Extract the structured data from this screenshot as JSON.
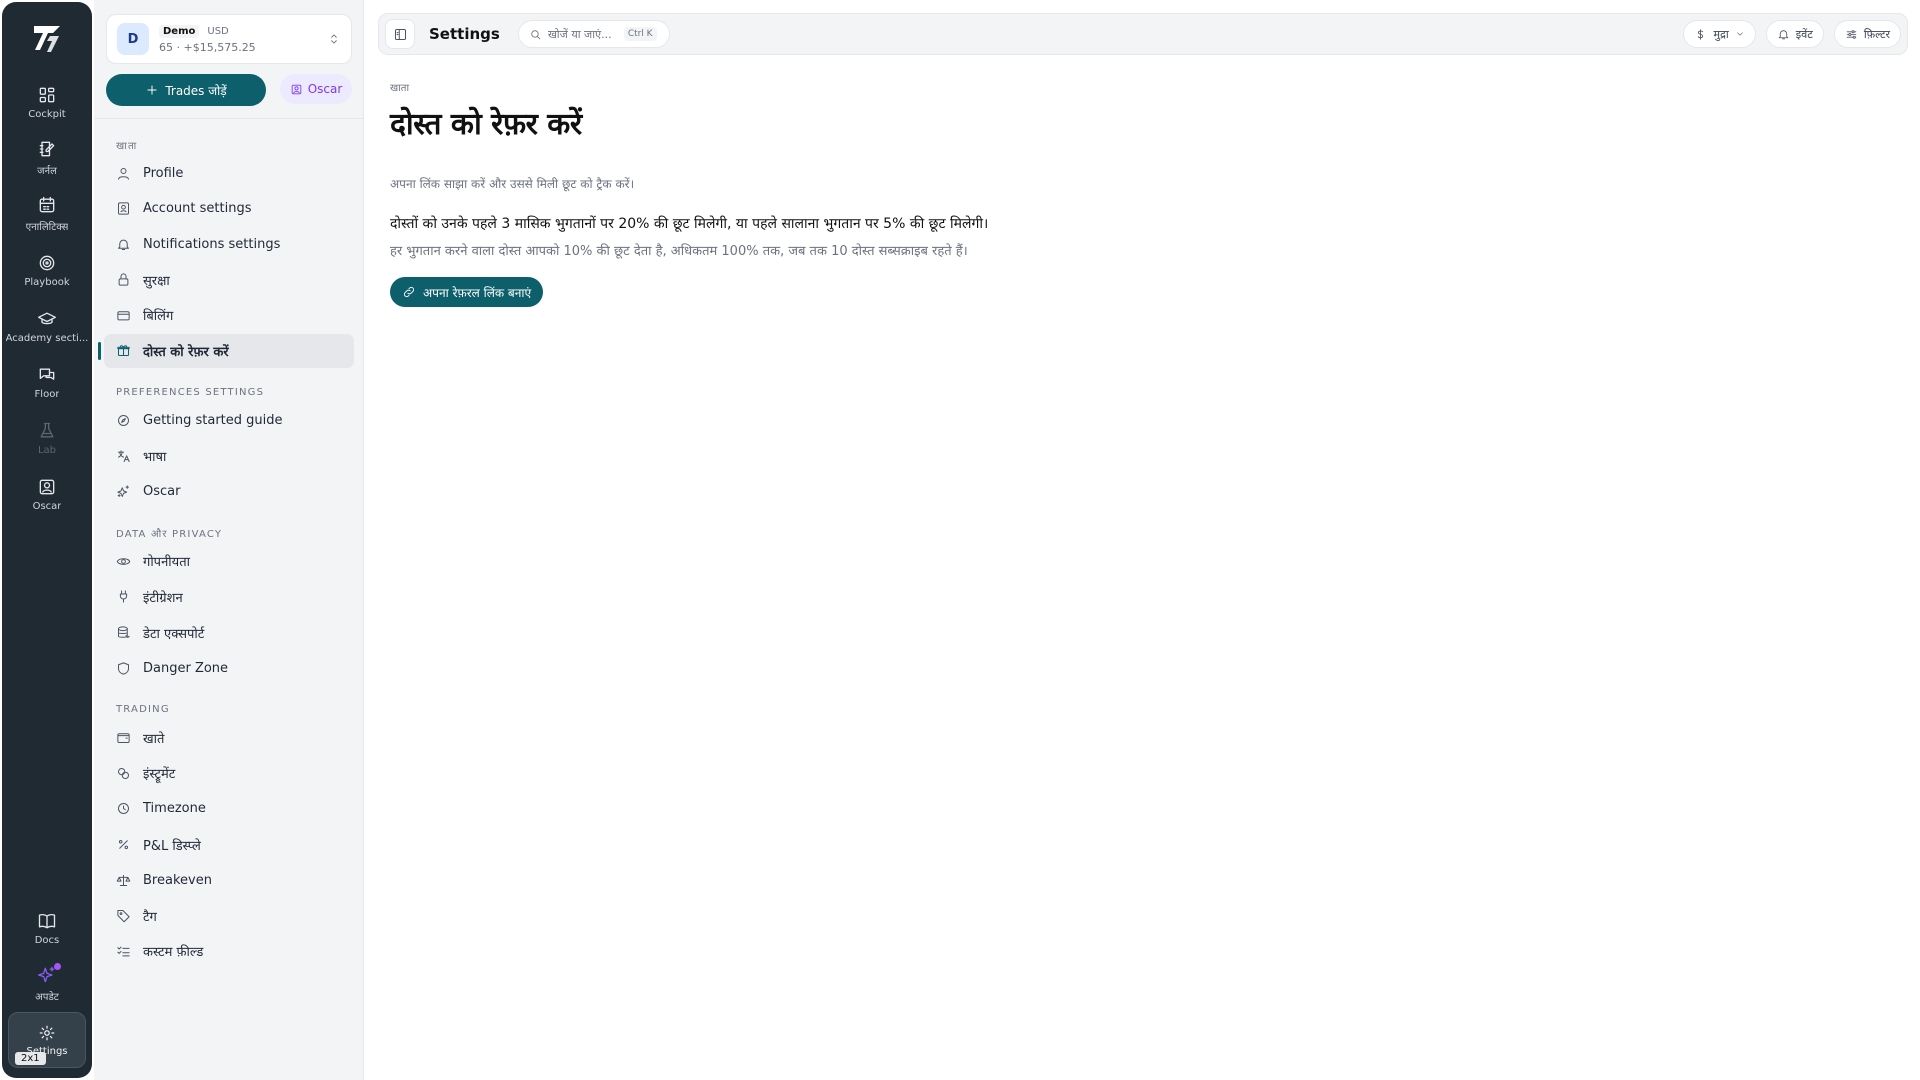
{
  "rail": {
    "items": [
      {
        "label": "Cockpit",
        "icon": "grid-icon"
      },
      {
        "label": "जर्नल",
        "icon": "journal-icon"
      },
      {
        "label": "एनालिटिक्स",
        "icon": "calendar-icon"
      },
      {
        "label": "Playbook",
        "icon": "target-icon"
      },
      {
        "label": "Academy secti...",
        "icon": "graduation-cap-icon"
      },
      {
        "label": "Floor",
        "icon": "chat-icon"
      },
      {
        "label": "Lab",
        "icon": "flask-icon",
        "disabled": true
      },
      {
        "label": "Oscar",
        "icon": "oscar-icon"
      }
    ],
    "bottom": {
      "docs": "Docs",
      "updates": "अपडेट",
      "settings": "Settings",
      "badge": "2x1"
    }
  },
  "account": {
    "avatar": "D",
    "mode": "Demo",
    "currency": "USD",
    "balance": "65 · +$15,575.25"
  },
  "actions": {
    "add_trades": "Trades जोड़ें",
    "oscar": "Oscar"
  },
  "menu": {
    "account_label": "खाता",
    "account_items": [
      {
        "label": "Profile",
        "icon": "user-icon"
      },
      {
        "label": "Account settings",
        "icon": "id-card-icon"
      },
      {
        "label": "Notifications settings",
        "icon": "bell-icon"
      },
      {
        "label": "सुरक्षा",
        "icon": "lock-icon"
      },
      {
        "label": "बिलिंग",
        "icon": "credit-card-icon"
      },
      {
        "label": "दोस्त को रेफ़र करें",
        "icon": "gift-icon",
        "active": true
      }
    ],
    "preferences_label": "Preferences settings",
    "preferences_items": [
      {
        "label": "Getting started guide",
        "icon": "compass-icon"
      },
      {
        "label": "भाषा",
        "icon": "translate-icon"
      },
      {
        "label": "Oscar",
        "icon": "sparkles-icon"
      }
    ],
    "data_label": "Data और Privacy",
    "data_items": [
      {
        "label": "गोपनीयता",
        "icon": "eye-icon"
      },
      {
        "label": "इंटीग्रेशन",
        "icon": "plug-icon"
      },
      {
        "label": "डेटा एक्सपोर्ट",
        "icon": "database-icon"
      },
      {
        "label": "Danger Zone",
        "icon": "shield-icon"
      }
    ],
    "trading_label": "Trading",
    "trading_items": [
      {
        "label": "खाते",
        "icon": "wallet-icon"
      },
      {
        "label": "इंस्ट्रूमेंट",
        "icon": "coins-icon"
      },
      {
        "label": "Timezone",
        "icon": "clock-icon"
      },
      {
        "label": "P&L डिस्प्ले",
        "icon": "percent-icon"
      },
      {
        "label": "Breakeven",
        "icon": "scale-icon"
      },
      {
        "label": "टैग",
        "icon": "tag-icon"
      },
      {
        "label": "कस्टम फ़ील्ड",
        "icon": "checklist-icon"
      }
    ]
  },
  "topbar": {
    "title": "Settings",
    "search_placeholder": "खोजें या जाएं...",
    "search_shortcut": "Ctrl K",
    "currency": "मुद्रा",
    "events": "इवेंट",
    "filter": "फ़िल्टर"
  },
  "main": {
    "breadcrumb": "खाता",
    "title": "दोस्त को रेफ़र करें",
    "subtitle": "अपना लिंक साझा करें और उससे मिली छूट को ट्रैक करें।",
    "referral_headline": "दोस्तों को उनके पहले 3 मासिक भुगतानों पर 20% की छूट मिलेगी, या पहले सालाना भुगतान पर 5% की छूट मिलेगी।",
    "referral_note": "हर भुगतान करने वाला दोस्त आपको 10% की छूट देता है, अधिकतम 100% तक, जब तक 10 दोस्त सब्सक्राइब रहते हैं।",
    "cta": "अपना रेफ़रल लिंक बनाएं"
  },
  "colors": {
    "rail_bg": "#1f2a33",
    "accent": "#0d5f6b",
    "oscar_purple": "#7c3aed"
  }
}
